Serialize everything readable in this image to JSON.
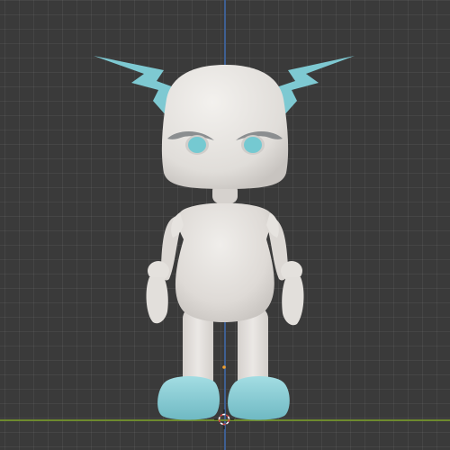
{
  "viewport": {
    "view": "front-orthographic",
    "colors": {
      "background": "#3a3a3a",
      "axis_z": "#3e5f92",
      "axis_x": "#6e8a2e",
      "model_body": "#e3e0dc",
      "model_accent": "#7ec9d2"
    },
    "cursor_icon": "3d-cursor-icon",
    "origin_icon": "object-origin-icon"
  }
}
